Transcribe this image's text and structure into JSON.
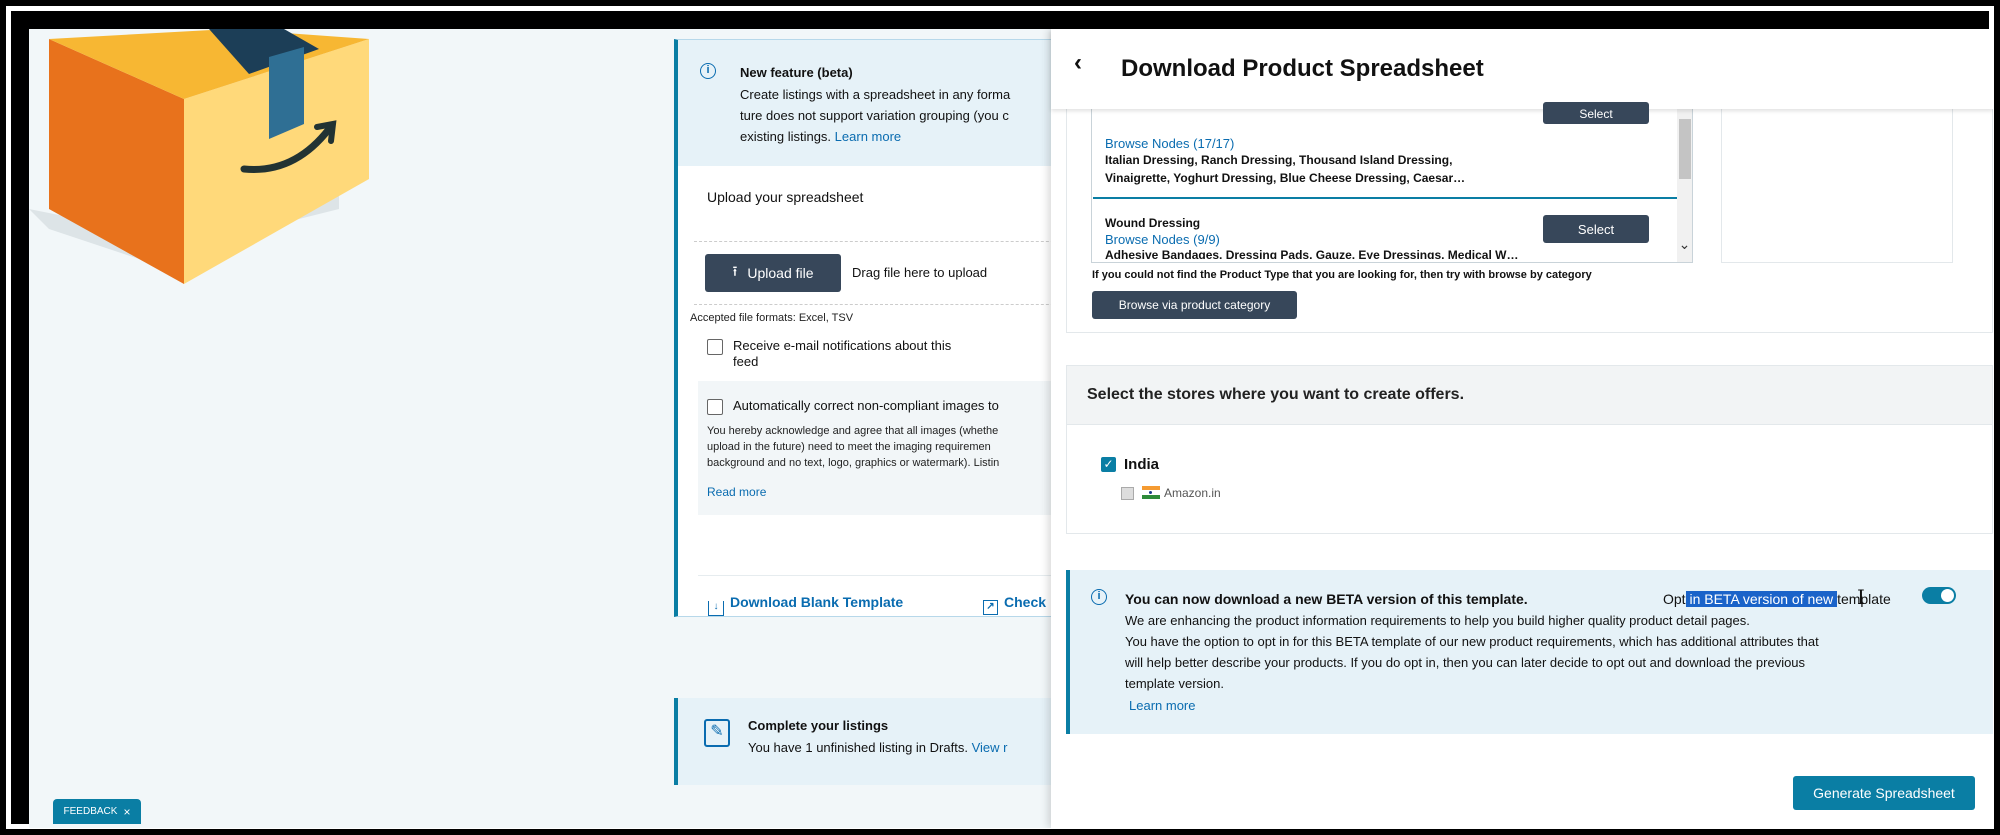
{
  "left": {
    "feature_banner": {
      "title": "New feature (beta)",
      "line1": "Create listings with a spreadsheet in any forma",
      "line2": "ture does not support variation grouping (you c",
      "line3_text": "existing listings.",
      "learn_more": "Learn more"
    },
    "upload": {
      "section_title": "Upload your spreadsheet",
      "upload_button": "Upload file",
      "drag_text": "Drag file here to upload",
      "accepted_formats": "Accepted file formats: Excel, TSV"
    },
    "email_notify": {
      "line1": "Receive e-mail notifications about this",
      "line2": "feed"
    },
    "auto_correct": {
      "label": "Automatically correct non-compliant images to",
      "body_line1": "You hereby acknowledge and agree that all images (whethe",
      "body_line2": "upload in the future) need to meet the imaging requiremen",
      "body_line3": "background and no text, logo, graphics or watermark). Listin",
      "read_more": "Read more"
    },
    "footer_links": {
      "download_blank": "Download Blank Template",
      "check": "Check"
    },
    "complete_listings": {
      "title": "Complete your listings",
      "text": "You have 1 unfinished listing in Drafts.",
      "view": "View r"
    },
    "feedback": {
      "label": "FEEDBACK",
      "close": "×"
    }
  },
  "panel": {
    "title": "Download Product Spreadsheet",
    "product_types": [
      {
        "name": "",
        "browse_nodes": "Browse Nodes (17/17)",
        "examples_line1": "Italian Dressing, Ranch Dressing, Thousand Island Dressing,",
        "examples_line2": "Vinaigrette, Yoghurt Dressing, Blue Cheese Dressing, Caesar…",
        "select_label": "Select"
      },
      {
        "name": "Wound Dressing",
        "browse_nodes": "Browse Nodes (9/9)",
        "examples_line1": "Adhesive Bandages, Dressing Pads, Gauze, Eye Dressings, Medical W…",
        "examples_line2": "",
        "select_label": "Select"
      }
    ],
    "not_found_text": "If you could not find the Product Type that you are looking for, then try with browse by category",
    "browse_category_button": "Browse via product category",
    "stores": {
      "heading": "Select the stores where you want to create offers.",
      "country": "India",
      "country_checked": true,
      "marketplace": "Amazon.in"
    },
    "beta": {
      "title": "You can now download a new BETA version of this template.",
      "opt_prefix": "Opt",
      "opt_highlight": " in BETA version of new ",
      "opt_suffix": "template",
      "toggle_on": true,
      "line1": "We are enhancing the product information requirements to help you build higher quality product detail pages.",
      "line2": "You have the option to opt in for this BETA template of our new product requirements, which has additional attributes that",
      "line3": "will help better describe your products. If you do opt in, then you can later decide to opt out and download the previous",
      "line4": "template version.",
      "learn_more": "Learn more"
    },
    "generate_button": "Generate Spreadsheet"
  },
  "colors": {
    "accent": "#0a7ea4",
    "info_bg": "#e6f2f8",
    "dark_button": "#37475a",
    "highlight": "#1a63c9",
    "toggle": "#0a7ea4"
  },
  "icons": [
    "amazon-box-logo",
    "info-icon",
    "upload-icon",
    "download-icon",
    "external-link-icon",
    "edit-icon",
    "back-chevron-icon",
    "scroll-up-icon",
    "scroll-down-icon",
    "india-flag-icon",
    "text-cursor-icon"
  ]
}
